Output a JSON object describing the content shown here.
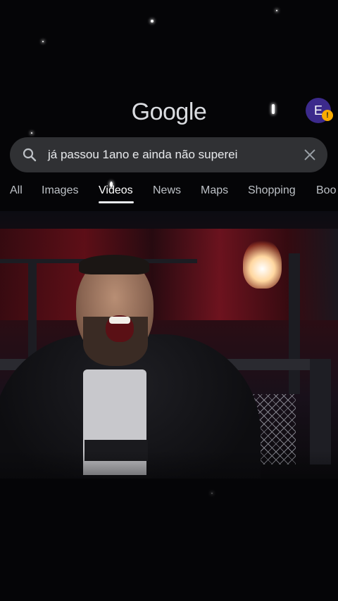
{
  "header": {
    "logo_text": "Google",
    "avatar_initial": "E",
    "avatar_alert": "!"
  },
  "search": {
    "query": "já passou 1ano e ainda não superei"
  },
  "tabs": [
    {
      "label": "All",
      "active": false
    },
    {
      "label": "Images",
      "active": false
    },
    {
      "label": "Videos",
      "active": true
    },
    {
      "label": "News",
      "active": false
    },
    {
      "label": "Maps",
      "active": false
    },
    {
      "label": "Shopping",
      "active": false
    },
    {
      "label": "Boo",
      "active": false
    }
  ],
  "colors": {
    "background": "#050507",
    "search_bar": "#303134",
    "avatar": "#3c2a8c",
    "alert": "#f9ab00"
  },
  "icons": {
    "search": "search-icon",
    "clear": "close-icon"
  }
}
